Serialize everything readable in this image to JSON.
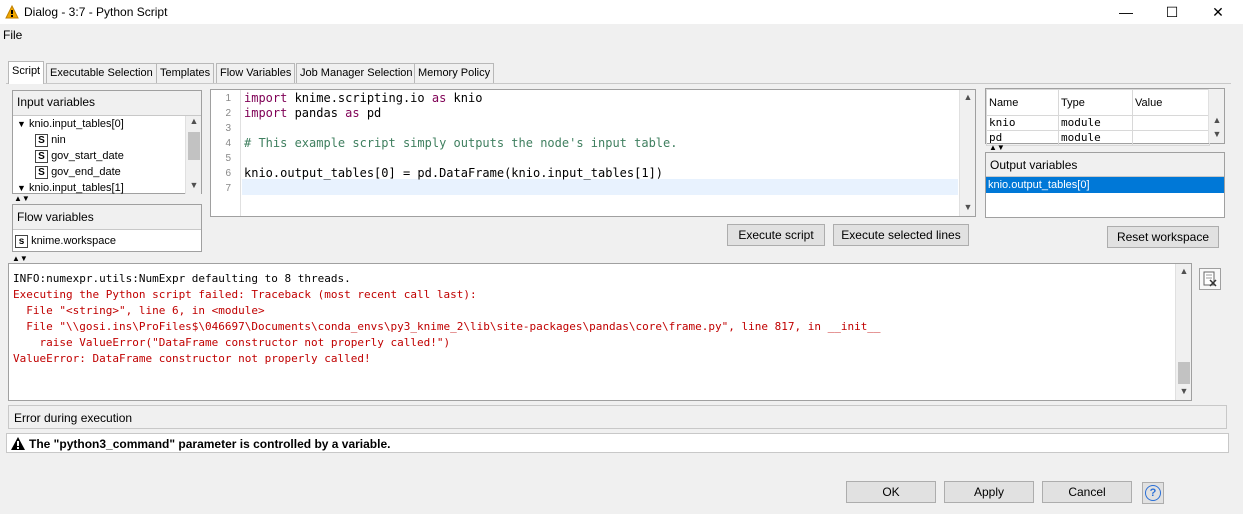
{
  "window": {
    "title": "Dialog - 3:7 - Python Script",
    "minimize": "—",
    "maximize": "☐",
    "close": "✕"
  },
  "menu": {
    "file": "File"
  },
  "tabs": [
    {
      "label": "Script"
    },
    {
      "label": "Executable Selection"
    },
    {
      "label": "Templates"
    },
    {
      "label": "Flow Variables"
    },
    {
      "label": "Job Manager Selection"
    },
    {
      "label": "Memory Policy"
    }
  ],
  "input_variables": {
    "header": "Input variables",
    "items": [
      {
        "label": "knio.input_tables[0]",
        "type": "group"
      },
      {
        "label": "nin",
        "type": "S"
      },
      {
        "label": "gov_start_date",
        "type": "S"
      },
      {
        "label": "gov_end_date",
        "type": "S"
      },
      {
        "label": "knio.input_tables[1]",
        "type": "group"
      }
    ]
  },
  "flow_variables": {
    "header": "Flow variables",
    "items": [
      {
        "label": "knime.workspace",
        "icon": "s"
      }
    ]
  },
  "editor": {
    "lines": [
      {
        "n": "1",
        "parts": [
          {
            "t": "import",
            "c": "kw"
          },
          {
            "t": " knime.scripting.io ",
            "c": ""
          },
          {
            "t": "as",
            "c": "kw"
          },
          {
            "t": " knio",
            "c": ""
          }
        ]
      },
      {
        "n": "2",
        "parts": [
          {
            "t": "import",
            "c": "kw"
          },
          {
            "t": " pandas ",
            "c": ""
          },
          {
            "t": "as",
            "c": "kw"
          },
          {
            "t": " pd",
            "c": ""
          }
        ]
      },
      {
        "n": "3",
        "parts": []
      },
      {
        "n": "4",
        "parts": [
          {
            "t": "# This example script simply outputs the node's input table.",
            "c": "cm"
          }
        ]
      },
      {
        "n": "5",
        "parts": []
      },
      {
        "n": "6",
        "parts": [
          {
            "t": "knio.output_tables[0] = pd.DataFrame(knio.input_tables[1])",
            "c": ""
          }
        ]
      },
      {
        "n": "7",
        "parts": []
      }
    ],
    "execute_script": "Execute script",
    "execute_selected": "Execute selected lines"
  },
  "workspace": {
    "columns": [
      "Name",
      "Type",
      "Value"
    ],
    "rows": [
      {
        "name": "knio",
        "type": "module",
        "value": ""
      },
      {
        "name": "pd",
        "type": "module",
        "value": ""
      }
    ],
    "output_header": "Output variables",
    "output_items": [
      "knio.output_tables[0]"
    ],
    "reset": "Reset workspace"
  },
  "console": {
    "lines": [
      {
        "t": "INFO:numexpr.utils:NumExpr defaulting to 8 threads.",
        "err": false
      },
      {
        "t": "Executing the Python script failed: Traceback (most recent call last):",
        "err": true
      },
      {
        "t": "  File \"<string>\", line 6, in <module>",
        "err": true
      },
      {
        "t": "  File \"\\\\gosi.ins\\ProFiles$\\046697\\Documents\\conda_envs\\py3_knime_2\\lib\\site-packages\\pandas\\core\\frame.py\", line 817, in __init__",
        "err": true
      },
      {
        "t": "    raise ValueError(\"DataFrame constructor not properly called!\")",
        "err": true
      },
      {
        "t": "ValueError: DataFrame constructor not properly called!",
        "err": true
      }
    ]
  },
  "status": "Error during execution",
  "warning": "The \"python3_command\" parameter is controlled by a variable.",
  "buttons": {
    "ok": "OK",
    "apply": "Apply",
    "cancel": "Cancel",
    "help": "?"
  },
  "colors": {
    "selection": "#0078d7",
    "error": "#c00000",
    "keyword": "#7f0055",
    "comment": "#3f7f5f",
    "warn_icon": "#f2a800"
  }
}
